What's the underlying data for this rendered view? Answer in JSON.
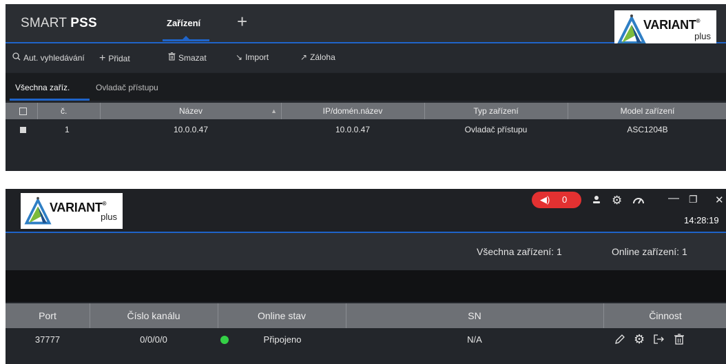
{
  "app": {
    "brand_light": "SMART ",
    "brand_bold": "PSS",
    "tab_devices": "Zařízení",
    "tab_add": "+"
  },
  "logo": {
    "word": "VARIANT",
    "registered": "®",
    "sub": "plus"
  },
  "toolbar": {
    "search": {
      "icon": "search-icon",
      "label": "Aut. vyhledávání"
    },
    "add": {
      "icon": "plus-icon",
      "label": "Přidat"
    },
    "delete": {
      "icon": "trash-icon",
      "label": "Smazat"
    },
    "import": {
      "icon": "import-icon",
      "label": "Import"
    },
    "backup": {
      "icon": "backup-icon",
      "label": "Záloha"
    }
  },
  "device_tabs": {
    "all": "Všechna zaříz.",
    "access": "Ovladač přístupu"
  },
  "device_table": {
    "columns": [
      "č.",
      "Název",
      "IP/domén.název",
      "Typ zařízení",
      "Model zařízení"
    ],
    "rows": [
      {
        "no": "1",
        "name": "10.0.0.47",
        "ip": "10.0.0.47",
        "type": "Ovladač přístupu",
        "model": "ASC1204B"
      }
    ]
  },
  "topbar": {
    "alarm_count": "0",
    "icons": [
      "speaker-icon",
      "user-icon",
      "gear-icon",
      "gauge-icon",
      "minimize-icon",
      "restore-icon",
      "close-icon"
    ],
    "minimize": "—",
    "restore": "❐",
    "close": "✕",
    "time": "14:28:19"
  },
  "stats": {
    "all_devices": "Všechna zařízení:  1",
    "online_devices": "Online zařízení:  1"
  },
  "status_table": {
    "columns": [
      "Port",
      "Číslo kanálu",
      "Online stav",
      "SN",
      "Činnost"
    ],
    "rows": [
      {
        "port": "37777",
        "channel": "0/0/0/0",
        "status": "Připojeno",
        "sn": "N/A"
      }
    ],
    "actions": [
      "pencil-icon",
      "settings-icon",
      "export-icon",
      "trash-icon"
    ]
  },
  "colors": {
    "accent": "#1f64c9",
    "alarm": "#e33131",
    "online": "#34d046",
    "header_gray": "#6d7075",
    "panel_dark": "#23262b"
  }
}
